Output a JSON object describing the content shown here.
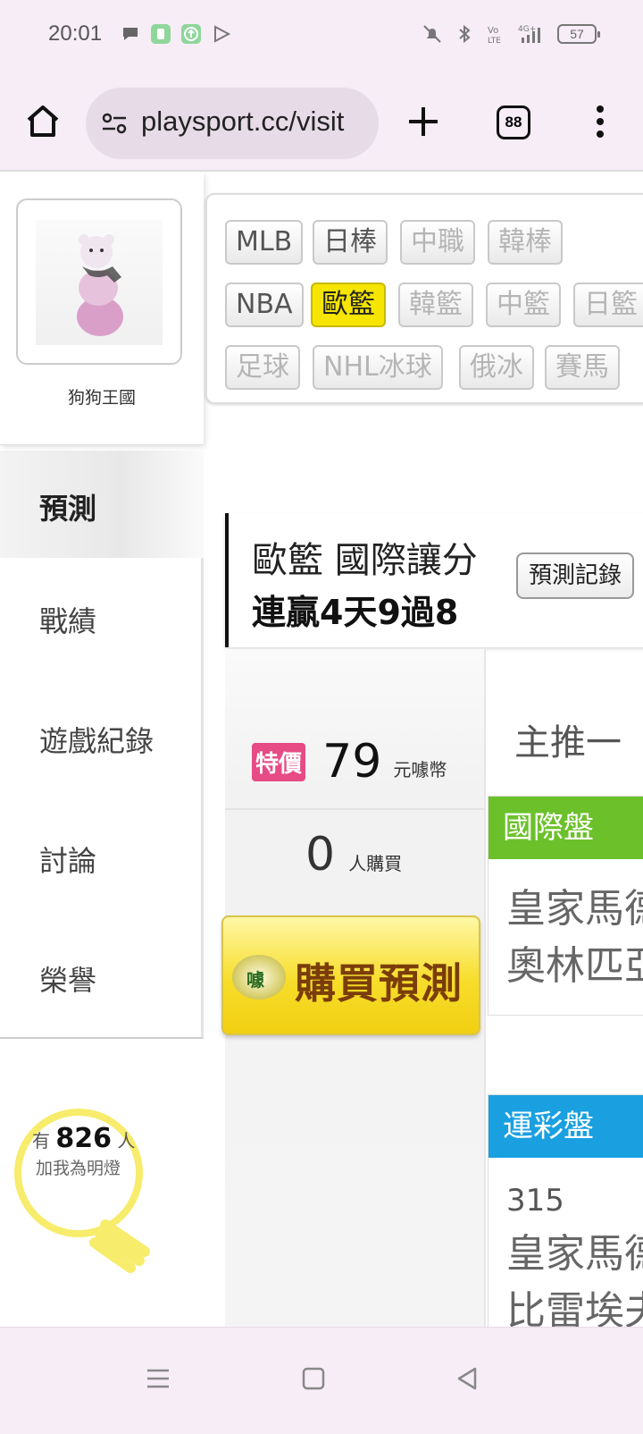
{
  "status_bar": {
    "time": "20:01",
    "battery": "57",
    "left_icons": [
      "chat-icon",
      "app-icon",
      "upload-icon",
      "play-icon"
    ],
    "right_icons": [
      "mute-icon",
      "bluetooth-icon",
      "volte-icon",
      "signal-4g-icon",
      "battery-icon"
    ]
  },
  "browser": {
    "url": "playsport.cc/visit",
    "tab_count": "88"
  },
  "profile": {
    "name": "狗狗王國"
  },
  "nav": {
    "predict": "預測",
    "items": [
      "戰績",
      "遊戲紀錄",
      "討論",
      "榮譽"
    ]
  },
  "bulb": {
    "prefix": "有",
    "count": "826",
    "suffix": "人",
    "line2": "加我為明燈"
  },
  "sport_tabs": {
    "row1": [
      "MLB",
      "日棒",
      "中職",
      "韓棒"
    ],
    "row2": [
      "NBA",
      "歐籃",
      "韓籃",
      "中籃",
      "日籃"
    ],
    "row3": [
      "足球",
      "NHL冰球",
      "俄冰",
      "賽馬"
    ],
    "active": "歐籃"
  },
  "prediction": {
    "title": "歐籃 國際讓分",
    "streak": "連贏4天9過8",
    "record_button": "預測記錄"
  },
  "purchase": {
    "sale_badge": "特價",
    "price": "79",
    "price_unit": "元噱幣",
    "buyers": "0",
    "buyers_unit": "人購買",
    "buy_button": "購買預測",
    "buy_icon_text": "噱"
  },
  "main_recommend": "主推一",
  "cards": {
    "intl": {
      "header": "國際盤",
      "lines": [
        "皇家馬德里",
        "奧林匹亞"
      ]
    },
    "lottery": {
      "header": "運彩盤",
      "number": "315",
      "lines": [
        "皇家馬德里",
        "比雷埃夫斯"
      ]
    }
  },
  "colors": {
    "active_tab": "#f5e500",
    "sale_badge": "#e64b85",
    "intl_header": "#6cc12b",
    "lottery_header": "#1aa0e0",
    "chrome_bg": "#f6edf6"
  }
}
